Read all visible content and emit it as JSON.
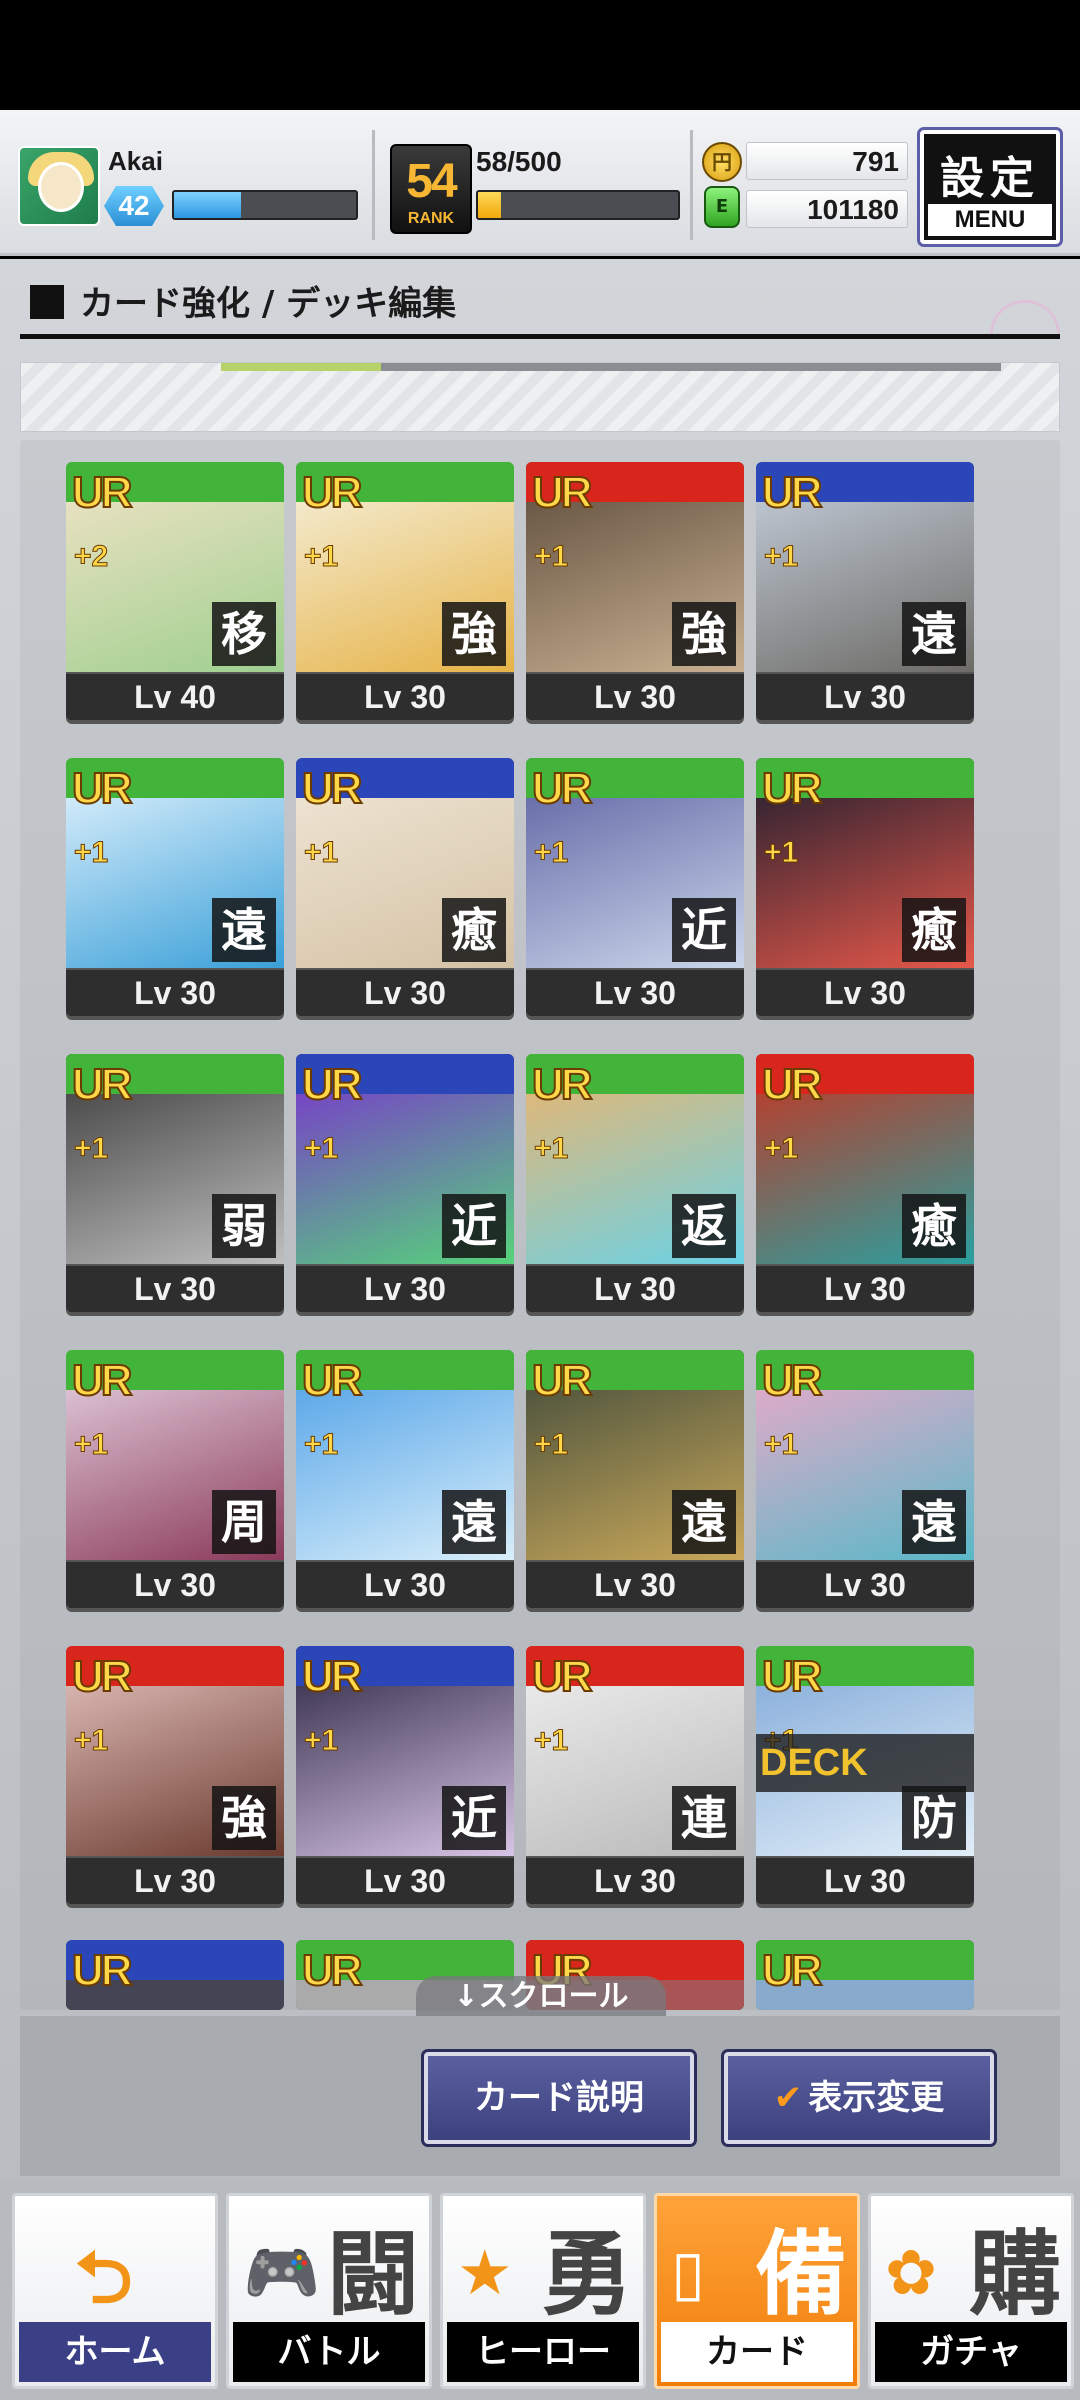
{
  "player": {
    "name": "Akai",
    "level": "42",
    "exp_fraction": 0.37,
    "rank": "54",
    "rank_label": "RANK",
    "rank_progress_text": "58/500",
    "rank_fraction": 0.116,
    "coins": "791",
    "coin_icon_text": "円",
    "energy": "101180",
    "energy_icon_text": "E"
  },
  "menu_button": {
    "kanji": "設定",
    "label": "MENU"
  },
  "section_title": "カード強化 / デッキ編集",
  "cards": [
    {
      "rarity": "UR",
      "plus": "+2",
      "role": "移",
      "level": "Lv 40",
      "colors": [
        "#43b43a",
        "#f3e4c8",
        "#9fcf8f"
      ]
    },
    {
      "rarity": "UR",
      "plus": "+1",
      "role": "強",
      "level": "Lv 30",
      "colors": [
        "#43b43a",
        "#f5f2e0",
        "#e6b347"
      ]
    },
    {
      "rarity": "UR",
      "plus": "+1",
      "role": "強",
      "level": "Lv 30",
      "colors": [
        "#d9261c",
        "#5b4a3a",
        "#c9b091"
      ]
    },
    {
      "rarity": "UR",
      "plus": "+1",
      "role": "遠",
      "level": "Lv 30",
      "colors": [
        "#2a46b8",
        "#c8d2e0",
        "#6d6b66"
      ]
    },
    {
      "rarity": "UR",
      "plus": "+1",
      "role": "遠",
      "level": "Lv 30",
      "colors": [
        "#43b43a",
        "#e9f6ff",
        "#3aa0d8"
      ]
    },
    {
      "rarity": "UR",
      "plus": "+1",
      "role": "癒",
      "level": "Lv 30",
      "colors": [
        "#2a46b8",
        "#f1e8d8",
        "#d4c2a5"
      ]
    },
    {
      "rarity": "UR",
      "plus": "+1",
      "role": "近",
      "level": "Lv 30",
      "colors": [
        "#43b43a",
        "#5b5fa0",
        "#c9d6ea"
      ]
    },
    {
      "rarity": "UR",
      "plus": "+1",
      "role": "癒",
      "level": "Lv 30",
      "colors": [
        "#43b43a",
        "#1b1d2e",
        "#e6584a"
      ]
    },
    {
      "rarity": "UR",
      "plus": "+1",
      "role": "弱",
      "level": "Lv 30",
      "colors": [
        "#43b43a",
        "#3a3a3a",
        "#bfbfbf"
      ]
    },
    {
      "rarity": "UR",
      "plus": "+1",
      "role": "近",
      "level": "Lv 30",
      "colors": [
        "#2a46b8",
        "#7b2fd1",
        "#55d47a"
      ]
    },
    {
      "rarity": "UR",
      "plus": "+1",
      "role": "返",
      "level": "Lv 30",
      "colors": [
        "#43b43a",
        "#f0b46a",
        "#6ad2e6"
      ]
    },
    {
      "rarity": "UR",
      "plus": "+1",
      "role": "癒",
      "level": "Lv 30",
      "colors": [
        "#d9261c",
        "#c8331f",
        "#2aa0a0"
      ]
    },
    {
      "rarity": "UR",
      "plus": "+1",
      "role": "周",
      "level": "Lv 30",
      "colors": [
        "#43b43a",
        "#e8d5e4",
        "#8a3a5a"
      ]
    },
    {
      "rarity": "UR",
      "plus": "+1",
      "role": "遠",
      "level": "Lv 30",
      "colors": [
        "#43b43a",
        "#4a9ee6",
        "#d8eefa"
      ]
    },
    {
      "rarity": "UR",
      "plus": "+1",
      "role": "遠",
      "level": "Lv 30",
      "colors": [
        "#43b43a",
        "#3f4a3a",
        "#c9a85a"
      ]
    },
    {
      "rarity": "UR",
      "plus": "+1",
      "role": "遠",
      "level": "Lv 30",
      "colors": [
        "#43b43a",
        "#f2a9c9",
        "#5ab8c8"
      ]
    },
    {
      "rarity": "UR",
      "plus": "+1",
      "role": "強",
      "level": "Lv 30",
      "colors": [
        "#d9261c",
        "#e9c7c4",
        "#6a3a2e"
      ]
    },
    {
      "rarity": "UR",
      "plus": "+1",
      "role": "近",
      "level": "Lv 30",
      "colors": [
        "#2a46b8",
        "#2a2440",
        "#d8c4e6"
      ]
    },
    {
      "rarity": "UR",
      "plus": "+1",
      "role": "連",
      "level": "Lv 30",
      "colors": [
        "#d9261c",
        "#f1f1f1",
        "#b9b9b9"
      ]
    },
    {
      "rarity": "UR",
      "plus": "+1",
      "role": "防",
      "level": "Lv 30",
      "colors": [
        "#43b43a",
        "#7fa8d8",
        "#e2eef8"
      ],
      "deck": "DECK"
    }
  ],
  "partial_cards": [
    {
      "rarity": "UR",
      "colors": [
        "#2a46b8",
        "#445"
      ]
    },
    {
      "rarity": "UR",
      "colors": [
        "#43b43a",
        "#aaa"
      ]
    },
    {
      "rarity": "UR",
      "colors": [
        "#d9261c",
        "#a55"
      ]
    },
    {
      "rarity": "UR",
      "colors": [
        "#43b43a",
        "#8ac"
      ]
    }
  ],
  "scroll_hint": "↓スクロール",
  "actions": {
    "card_description": "カード説明",
    "view_change": "表示変更",
    "view_change_icon": "✔"
  },
  "nav": [
    {
      "id": "home",
      "label": "ホーム",
      "kanji": "",
      "icon": "⮌"
    },
    {
      "id": "battle",
      "label": "バトル",
      "kanji": "闘",
      "icon": "🎮"
    },
    {
      "id": "hero",
      "label": "ヒーロー",
      "kanji": "勇",
      "icon": "★"
    },
    {
      "id": "card",
      "label": "カード",
      "kanji": "備",
      "icon": "▯"
    },
    {
      "id": "gacha",
      "label": "ガチャ",
      "kanji": "購",
      "icon": "✿"
    }
  ],
  "active_nav": "card"
}
